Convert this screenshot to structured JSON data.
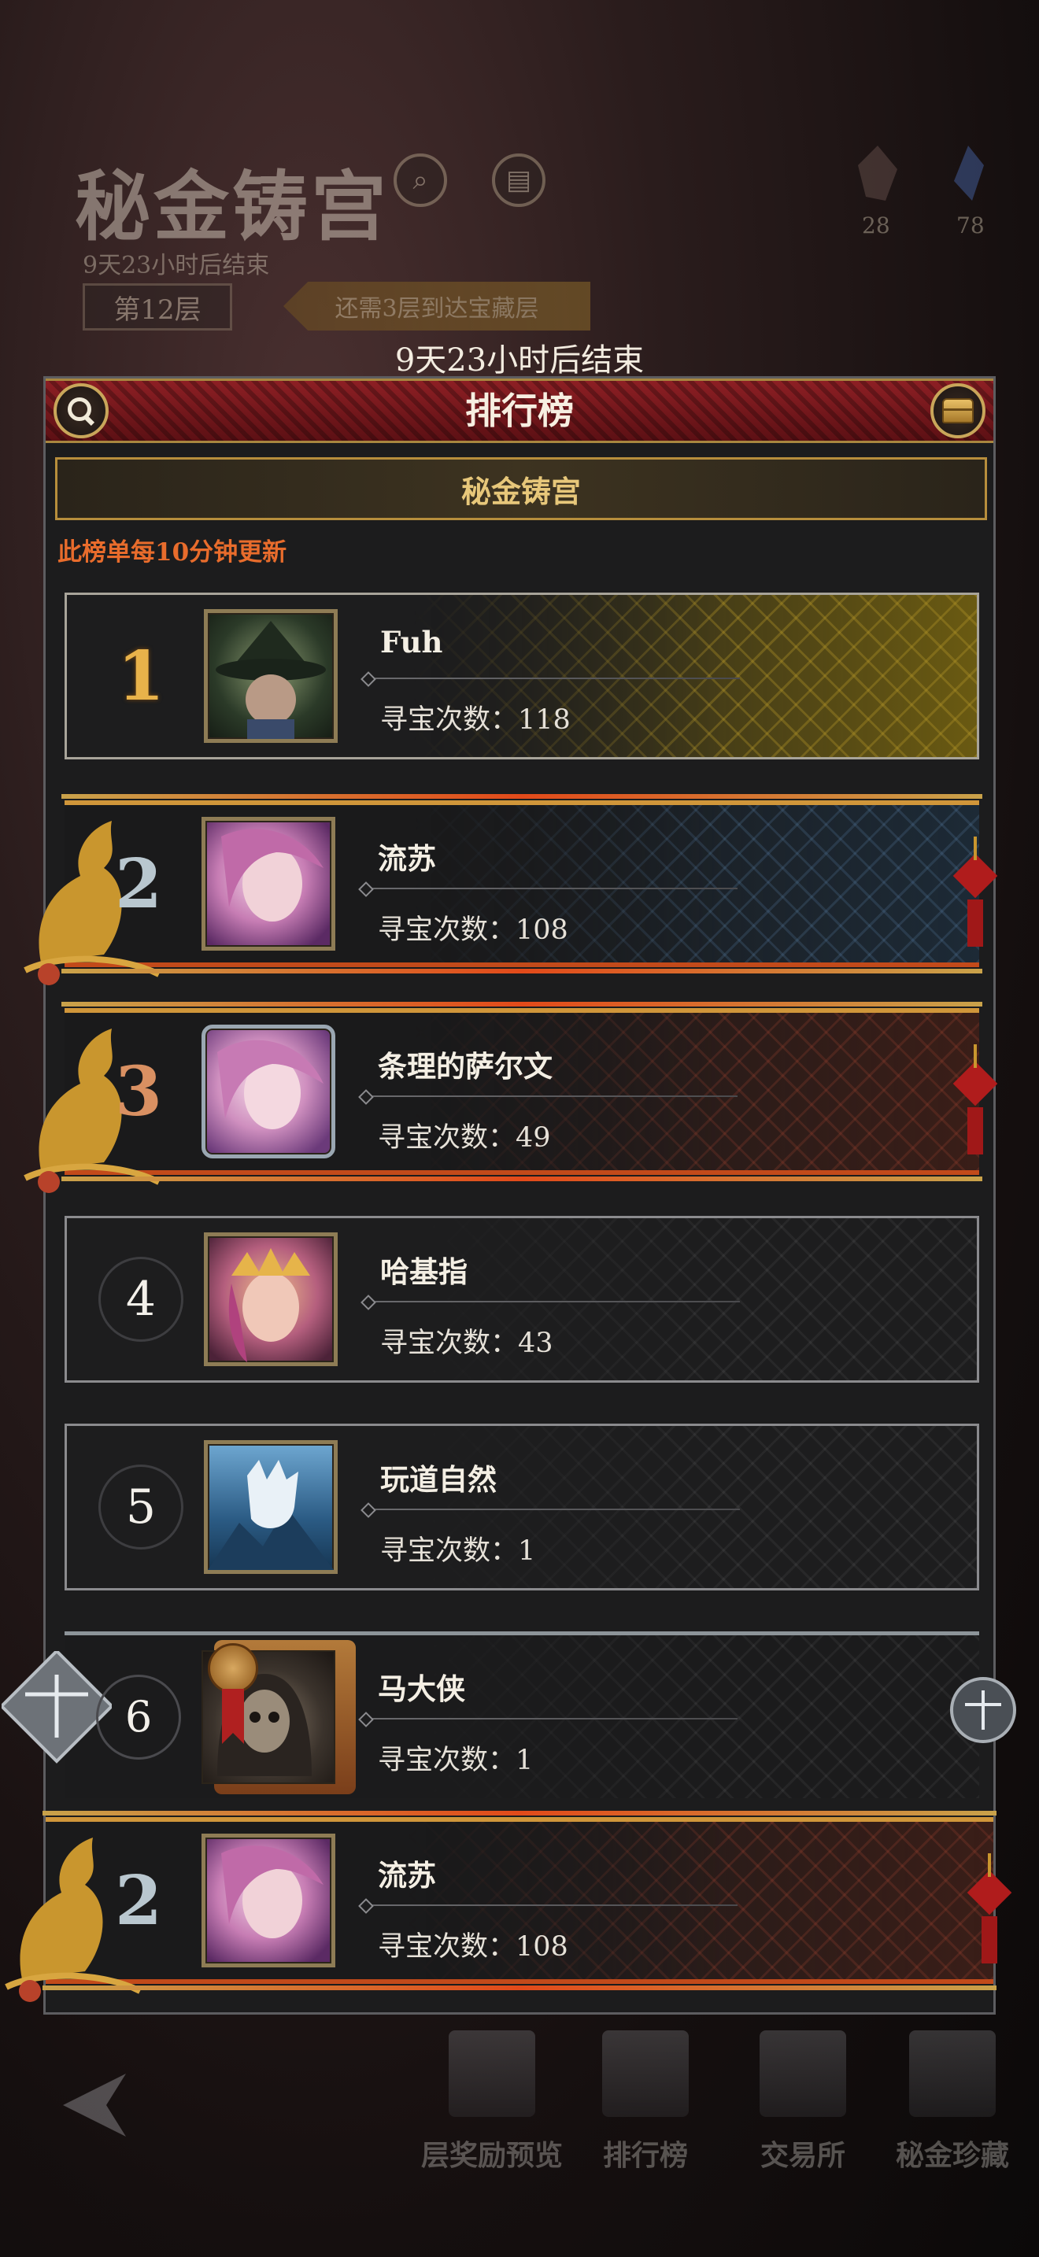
{
  "background": {
    "title": "秘金铸宫",
    "subtitle": "9天23小时后结束",
    "floor": "第12层",
    "banner": "还需3层到达宝藏层",
    "stat_left": "28",
    "stat_right": "78"
  },
  "timer": "9天23小时后结束",
  "panel": {
    "title": "排行榜",
    "sub_header": "秘金铸宫",
    "update_note": "此榜单每10分钟更新"
  },
  "rows": [
    {
      "rank": "1",
      "name": "Fuh",
      "stat": "寻宝次数：118"
    },
    {
      "rank": "2",
      "name": "流苏",
      "stat": "寻宝次数：108"
    },
    {
      "rank": "3",
      "name": "条理的萨尔文",
      "stat": "寻宝次数：49"
    },
    {
      "rank": "4",
      "name": "哈基指",
      "stat": "寻宝次数：43"
    },
    {
      "rank": "5",
      "name": "玩道自然",
      "stat": "寻宝次数：1"
    },
    {
      "rank": "6",
      "name": "马大侠",
      "stat": "寻宝次数：1"
    }
  ],
  "my_row": {
    "rank": "2",
    "name": "流苏",
    "stat": "寻宝次数：108"
  },
  "bottom_nav": {
    "items": [
      {
        "label": "层奖励预览",
        "icon": "tower-icon"
      },
      {
        "label": "排行榜",
        "icon": "trophy-icon"
      },
      {
        "label": "交易所",
        "icon": "merchant-icon"
      },
      {
        "label": "秘金珍藏",
        "icon": "treasure-icon"
      }
    ]
  },
  "colors": {
    "accent_gold": "#e7c77a",
    "header_red": "#8d1f24",
    "note_orange": "#e86c2c"
  }
}
